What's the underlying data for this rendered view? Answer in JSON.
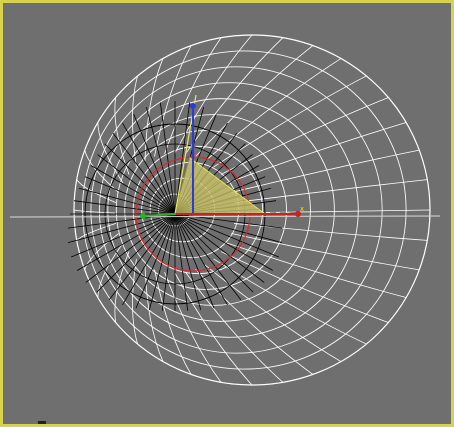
{
  "viewport": {
    "border_color": "#d7d34f",
    "background": "#6f6f6f"
  },
  "scene": {
    "sphere_wire_color": "#ffffff",
    "fan_wire_color": "#000000",
    "circle_color": "#d22b2b",
    "cone_fill_color": "#c8c26a",
    "cone_edge_color": "#e9e45a",
    "axis_x_label": "x"
  },
  "icons": {
    "gizmo": "transform-gizmo-icon"
  }
}
